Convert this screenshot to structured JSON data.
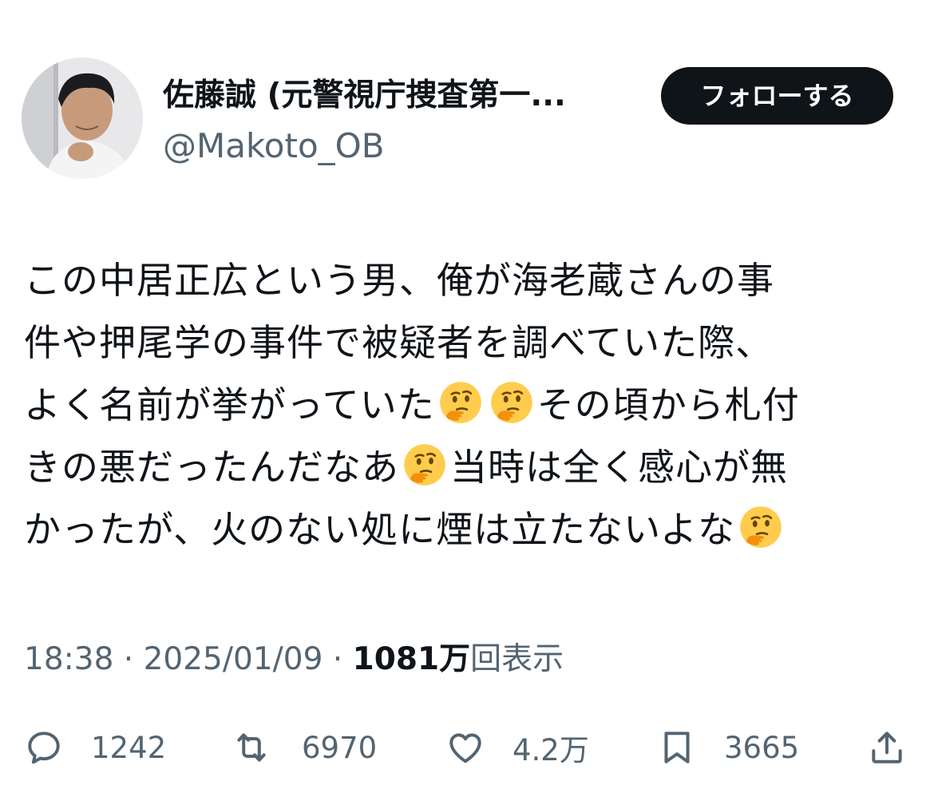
{
  "author": {
    "display_name": "佐藤誠 (元警視庁捜査第一...",
    "handle": "@Makoto_OB",
    "avatar_icon": "profile-photo"
  },
  "follow_button_label": "フォローする",
  "tweet": {
    "segments": [
      {
        "text": "この中居正広という男、俺が海老蔵さんの事"
      },
      {
        "text": "件や押尾学の事件で被疑者を調べていた際、"
      },
      {
        "text": "よく名前が挙がっていた",
        "emoji_after": 2,
        "tail": "その頃から札付"
      },
      {
        "text": "きの悪だったんだなあ",
        "emoji_after": 1,
        "tail": "当時は全く感心が無"
      },
      {
        "text": "かったが、火のない処に煙は立たないよな",
        "emoji_after": 1,
        "tail": ""
      }
    ],
    "emoji_name": "thinking-face"
  },
  "meta": {
    "time": "18:38",
    "separator": " · ",
    "date": "2025/01/09",
    "views_count": "1081万",
    "views_label": "回表示"
  },
  "actions": {
    "reply_count": "1242",
    "retweet_count": "6970",
    "like_count": "4.2万",
    "bookmark_count": "3665"
  },
  "colors": {
    "text": "#0f1419",
    "secondary": "#536471",
    "button_bg": "#0f1419",
    "button_text": "#ffffff"
  }
}
